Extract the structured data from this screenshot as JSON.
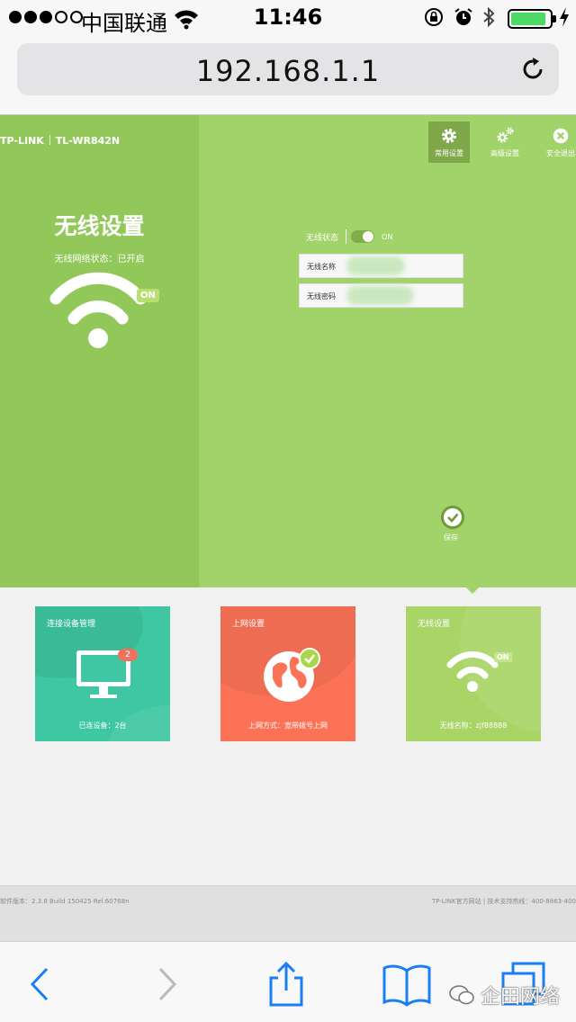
{
  "status_bar": {
    "signal_filled": 3,
    "signal_total": 5,
    "carrier": "中国联通",
    "time": "11:46",
    "battery_level": 0.85,
    "battery_color": "#4cd964"
  },
  "browser": {
    "url": "192.168.1.1",
    "reload_icon": "reload-icon"
  },
  "router": {
    "brand": "TP-LINK",
    "model": "TL-WR842N",
    "nav": [
      {
        "label": "常用设置",
        "icon": "gear-icon",
        "active": true
      },
      {
        "label": "高级设置",
        "icon": "gears-icon",
        "active": false
      },
      {
        "label": "安全退出",
        "icon": "close-circle-icon",
        "active": false
      }
    ],
    "left_panel": {
      "title": "无线设置",
      "status": "无线网络状态：已开启",
      "on_badge": "ON"
    },
    "form": {
      "status_label": "无线状态",
      "status_toggle": "ON",
      "ssid_label": "无线名称",
      "password_label": "无线密码"
    },
    "save_label": "保存",
    "colors": {
      "main": "#a2d36a",
      "left": "#92c859",
      "nav_active": "#7ea84a"
    }
  },
  "tiles": [
    {
      "title": "连接设备管理",
      "footer": "已连设备：2台",
      "badge": "2",
      "color": "#3ec7a2",
      "icon": "monitor-icon"
    },
    {
      "title": "上网设置",
      "footer": "上网方式：宽带拨号上网",
      "color": "#fb7257",
      "icon": "globe-icon"
    },
    {
      "title": "无线设置",
      "footer": "无线名称：zjf88888",
      "on_badge": "ON",
      "color": "#a9d466",
      "icon": "wifi-icon"
    }
  ],
  "footer": {
    "left": "软件版本：2.3.8 Build 150425 Rel.60768n",
    "right": "TP-LINK官方网站 | 技术支持热线：400-8863-400"
  },
  "toolbar": {
    "icons": [
      "back-icon",
      "forward-icon",
      "share-icon",
      "bookmarks-icon",
      "tabs-icon"
    ],
    "watermark": "企田网络"
  }
}
